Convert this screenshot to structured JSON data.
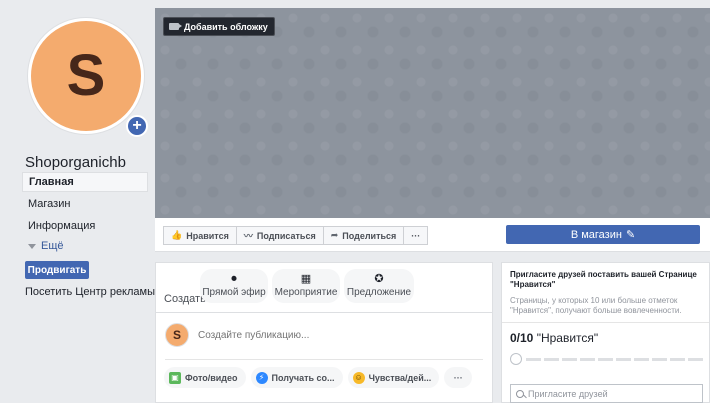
{
  "profile": {
    "avatar_letter": "S",
    "page_name": "Shoporganichb",
    "avatar_color": "#f4ab6e"
  },
  "nav": {
    "items": [
      "Главная",
      "Магазин",
      "Информация"
    ],
    "more_label": "Ещё"
  },
  "sidebar": {
    "promote_label": "Продвигать",
    "ads_center_label": "Посетить Центр рекламы"
  },
  "cover": {
    "add_cover_label": "Добавить обложку",
    "background_color": "#8d949e"
  },
  "actions": {
    "like_label": "Нравится",
    "follow_label": "Подписаться",
    "share_label": "Поделиться",
    "more_label": "···",
    "shop_label": "В магазин",
    "accent_color": "#4267b2"
  },
  "composer": {
    "create_label": "Создать",
    "live_label": "Прямой эфир",
    "event_label": "Мероприятие",
    "offer_label": "Предложение",
    "avatar_letter": "S",
    "placeholder": "Создайте публикацию...",
    "photo_label": "Фото/видео",
    "messages_label": "Получать со...",
    "feeling_label": "Чувства/дей...",
    "more_label": "···"
  },
  "invite": {
    "title": "Пригласите друзей поставить вашей Странице \"Нравится\"",
    "description": "Страницы, у которых 10 или больше отметок \"Нравится\", получают больше вовлеченности.",
    "count": "0/10",
    "count_suffix": "\"Нравится\"",
    "progress_current": 0,
    "progress_total": 10,
    "search_placeholder": "Пригласите друзей"
  }
}
